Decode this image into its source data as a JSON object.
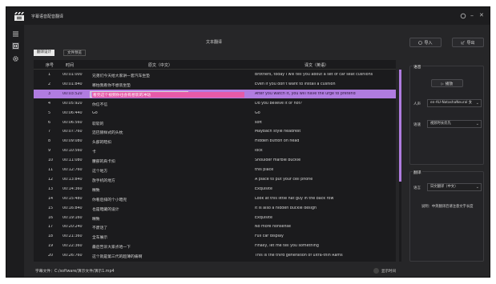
{
  "app": {
    "title": "字幕语音配音翻译"
  },
  "window_controls": {
    "close": "✕"
  },
  "header": {
    "title": "文本翻译",
    "import_label": "导入",
    "export_label": "导出"
  },
  "tabs": [
    {
      "label": "翻译设计"
    },
    {
      "label": "文件预览"
    }
  ],
  "table": {
    "columns": [
      "序号",
      "时间",
      "原文（中文）",
      "译文（英语）"
    ],
    "rows": [
      {
        "num": "1",
        "time": "00:01:000",
        "src": "兄弟们今天给大家讲一套汽车坐垫",
        "dst": "Brothers, today I will tell you about a set of car seat cushions"
      },
      {
        "num": "2",
        "time": "00:01:840",
        "src": "哪怕我看你不想装坐垫",
        "dst": "Even if you don't want to install a cushion"
      },
      {
        "num": "3",
        "time": "00:03:520",
        "src": "看完这个视频你也会有想装的冲动",
        "dst": "After you watch it, you will have the urge to pretend"
      },
      {
        "num": "4",
        "time": "00:05:920",
        "src": "你信不信",
        "dst": "Do you believe it or not?"
      },
      {
        "num": "5",
        "time": "00:06:440",
        "src": "Go",
        "dst": "Go"
      },
      {
        "num": "6",
        "time": "00:06:560",
        "src": "软软的",
        "dst": "soft"
      },
      {
        "num": "7",
        "time": "00:07:760",
        "src": "迈巴赫样式的头枕",
        "dst": "Maybach style headrest"
      },
      {
        "num": "8",
        "time": "00:09:080",
        "src": "头部的暗扣",
        "dst": "Hidden button on head"
      },
      {
        "num": "9",
        "time": "00:10:560",
        "src": "卡",
        "dst": "lock"
      },
      {
        "num": "10",
        "time": "00:11:080",
        "src": "腰部的肩卡扣",
        "dst": "Shoulder marble buckle"
      },
      {
        "num": "11",
        "time": "00:12:760",
        "src": "这个地方",
        "dst": "this place"
      },
      {
        "num": "12",
        "time": "00:13:840",
        "src": "放手机的地方",
        "dst": "A place to put your cell phone"
      },
      {
        "num": "13",
        "time": "00:14:360",
        "src": "精致",
        "dst": "Exquisite"
      },
      {
        "num": "14",
        "time": "00:15:480",
        "src": "你看后排的个小暗兜",
        "dst": "Look at this little hat guy in the back row"
      },
      {
        "num": "15",
        "time": "00:16:840",
        "src": "也是暗藏的设计",
        "dst": "It is also a hidden buckle design"
      },
      {
        "num": "16",
        "time": "00:19:160",
        "src": "精致",
        "dst": "Exquisite"
      },
      {
        "num": "17",
        "time": "00:20:240",
        "src": "不废话了",
        "dst": "No more nonsense"
      },
      {
        "num": "18",
        "time": "00:21:360",
        "src": "全车展示",
        "dst": "Full car display"
      },
      {
        "num": "19",
        "time": "00:22:360",
        "src": "最后告诉大家点哈一下",
        "dst": "Finally, let me tell you something"
      },
      {
        "num": "20",
        "time": "00:26:760",
        "src": "这个就是第三代的超薄的痛啊",
        "dst": "This is the third generation of ultra-thin Rams"
      }
    ]
  },
  "panel_voice": {
    "title": "语音",
    "play_label": "播放",
    "voice_label": "人声",
    "voice_value": "en-AU-NatashaNeural 女",
    "mode_label": "语速",
    "mode_value": "视频时长优先"
  },
  "panel_translate": {
    "title": "翻译",
    "lang_label": "语言",
    "lang_value": "日文翻译（中文）",
    "note": "说明：中英翻译后请注意文字长度"
  },
  "footer": {
    "path_label": "字幕文件：",
    "path_value": "C:/software/演示文件/演示1.mp4",
    "show_time_label": "显示时间"
  },
  "colors": {
    "selection": "#b07ce0",
    "highlight": "#e65aa8",
    "background": "#262628"
  }
}
